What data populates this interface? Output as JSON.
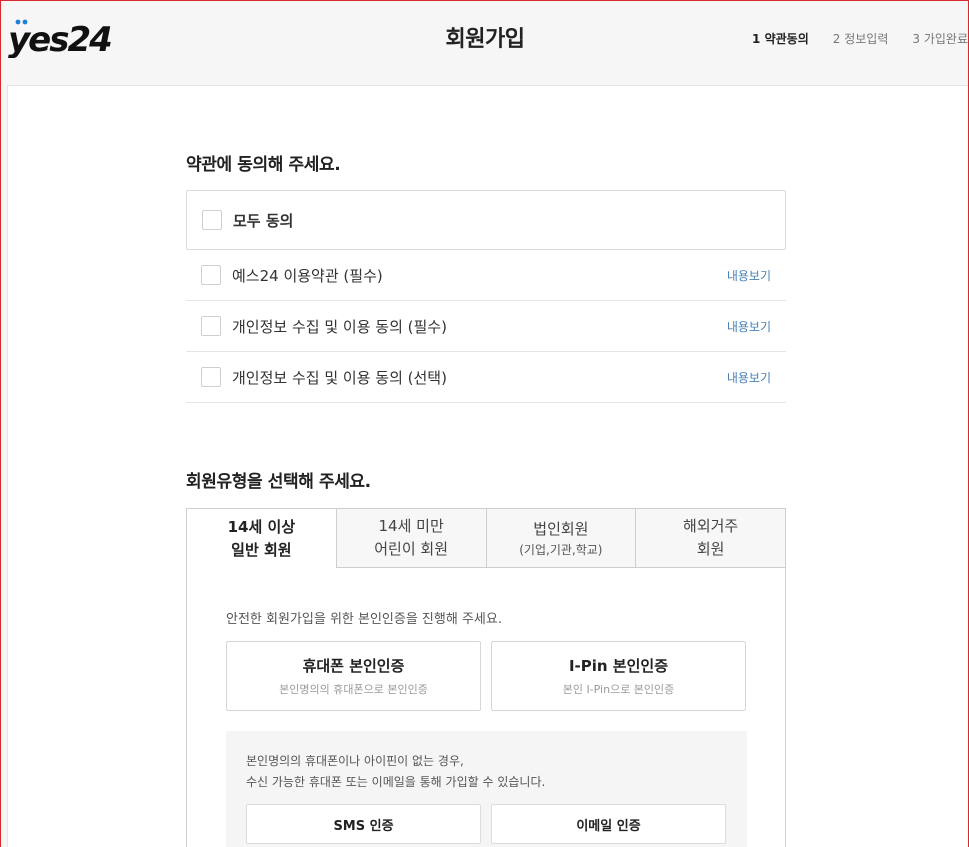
{
  "header": {
    "logo_text": "yes24",
    "title": "회원가입",
    "steps": [
      "1 약관동의",
      "2 정보입력",
      "3 가입완료"
    ]
  },
  "terms": {
    "title": "약관에 동의해 주세요.",
    "agree_all": "모두 동의",
    "view_label": "내용보기",
    "items": [
      "예스24 이용약관 (필수)",
      "개인정보 수집 및 이용 동의 (필수)",
      "개인정보 수집 및 이용 동의 (선택)"
    ]
  },
  "member_type": {
    "title": "회원유형을 선택해 주세요.",
    "tabs": [
      {
        "line1": "14세 이상",
        "line2": "일반 회원"
      },
      {
        "line1": "14세 미만",
        "line2": "어린이 회원"
      },
      {
        "line1": "법인회원",
        "line2": "(기업,기관,학교)"
      },
      {
        "line1": "해외거주",
        "line2": "회원"
      }
    ],
    "guide": "안전한 회원가입을 위한 본인인증을 진행해 주세요.",
    "auth_phone": {
      "title": "휴대폰 본인인증",
      "sub": "본인명의의 휴대폰으로 본인인증"
    },
    "auth_ipin": {
      "title": "I-Pin 본인인증",
      "sub": "본인 I-Pin으로 본인인증"
    },
    "alt_line1": "본인명의의 휴대폰이나 아이핀이 없는 경우,",
    "alt_line2": "수신 가능한 휴대폰 또는 이메일을 통해 가입할 수 있습니다.",
    "sms_label": "SMS 인증",
    "email_label": "이메일 인증"
  },
  "colors": {
    "frame_border": "#d9272e",
    "logo_accent": "#1e7fd8",
    "link": "#4a7fb5"
  }
}
